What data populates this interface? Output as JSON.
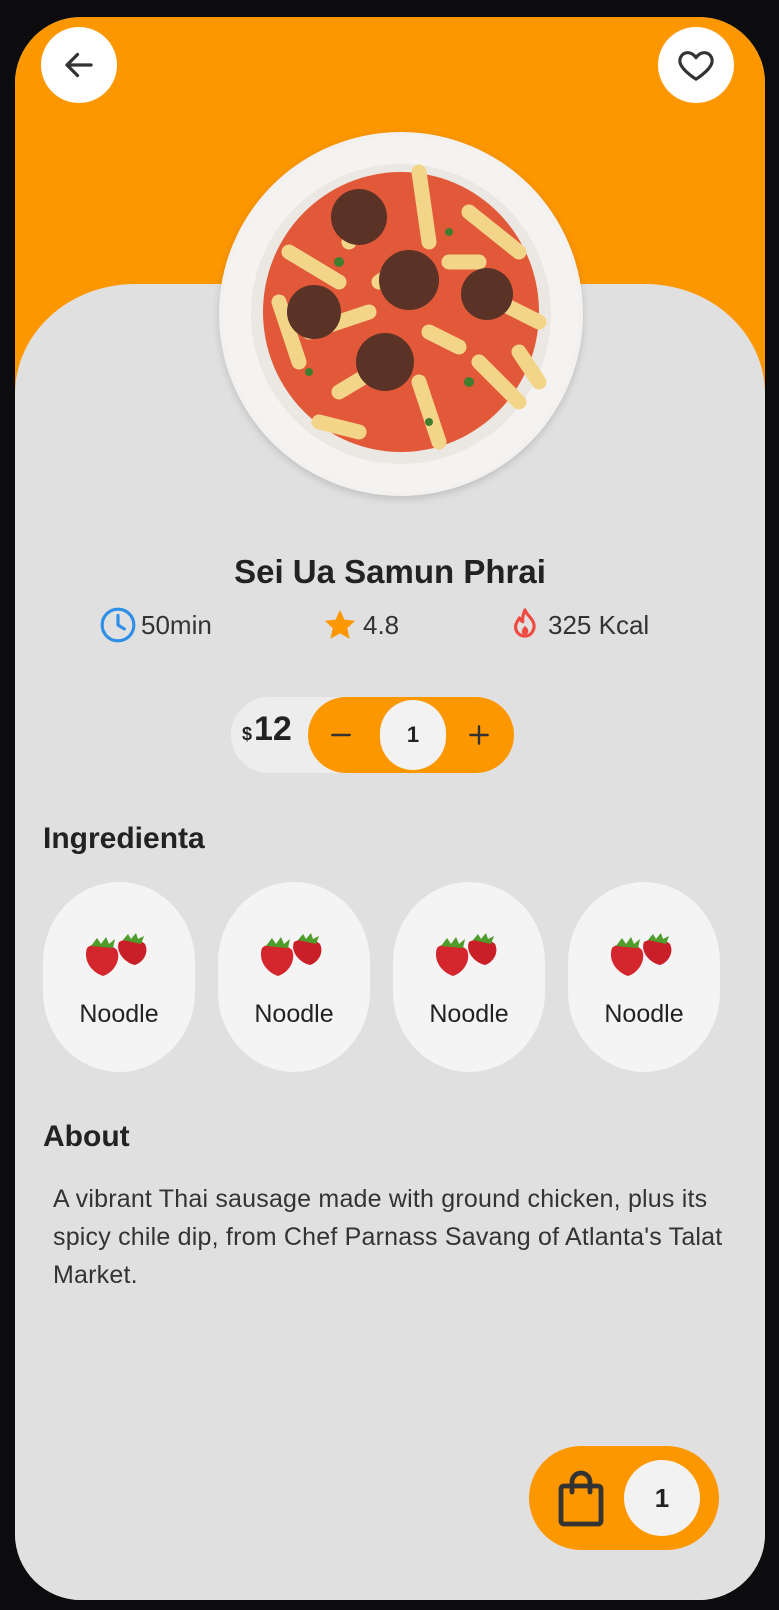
{
  "header": {
    "back_icon": "arrow-left-icon",
    "favorite_icon": "heart-outline-icon"
  },
  "dish": {
    "name": "Sei Ua Samun Phrai",
    "image": "pasta-with-meatballs-plate"
  },
  "stats": {
    "time": "50min",
    "rating": "4.8",
    "calories": "325 Kcal",
    "time_icon": "clock-icon",
    "rating_icon": "star-icon",
    "calories_icon": "flame-icon"
  },
  "price": {
    "currency": "$",
    "amount": "12"
  },
  "stepper": {
    "minus": "−",
    "quantity": "1",
    "plus": "+"
  },
  "ingredients": {
    "title": "Ingredienta",
    "items": [
      {
        "label": "Noodle",
        "icon": "strawberry-icon"
      },
      {
        "label": "Noodle",
        "icon": "strawberry-icon"
      },
      {
        "label": "Noodle",
        "icon": "strawberry-icon"
      },
      {
        "label": "Noodle",
        "icon": "strawberry-icon"
      }
    ]
  },
  "about": {
    "title": "About",
    "text": "A vibrant Thai sausage made with ground chicken, plus its spicy chile dip, from Chef Parnass Savang of Atlanta's Talat Market."
  },
  "cart": {
    "icon": "shopping-bag-icon",
    "count": "1"
  },
  "colors": {
    "accent": "#fd9700",
    "background": "#e0e0e0",
    "clock": "#2f8fe6",
    "star": "#fd9700",
    "flame": "#ef4b43"
  }
}
